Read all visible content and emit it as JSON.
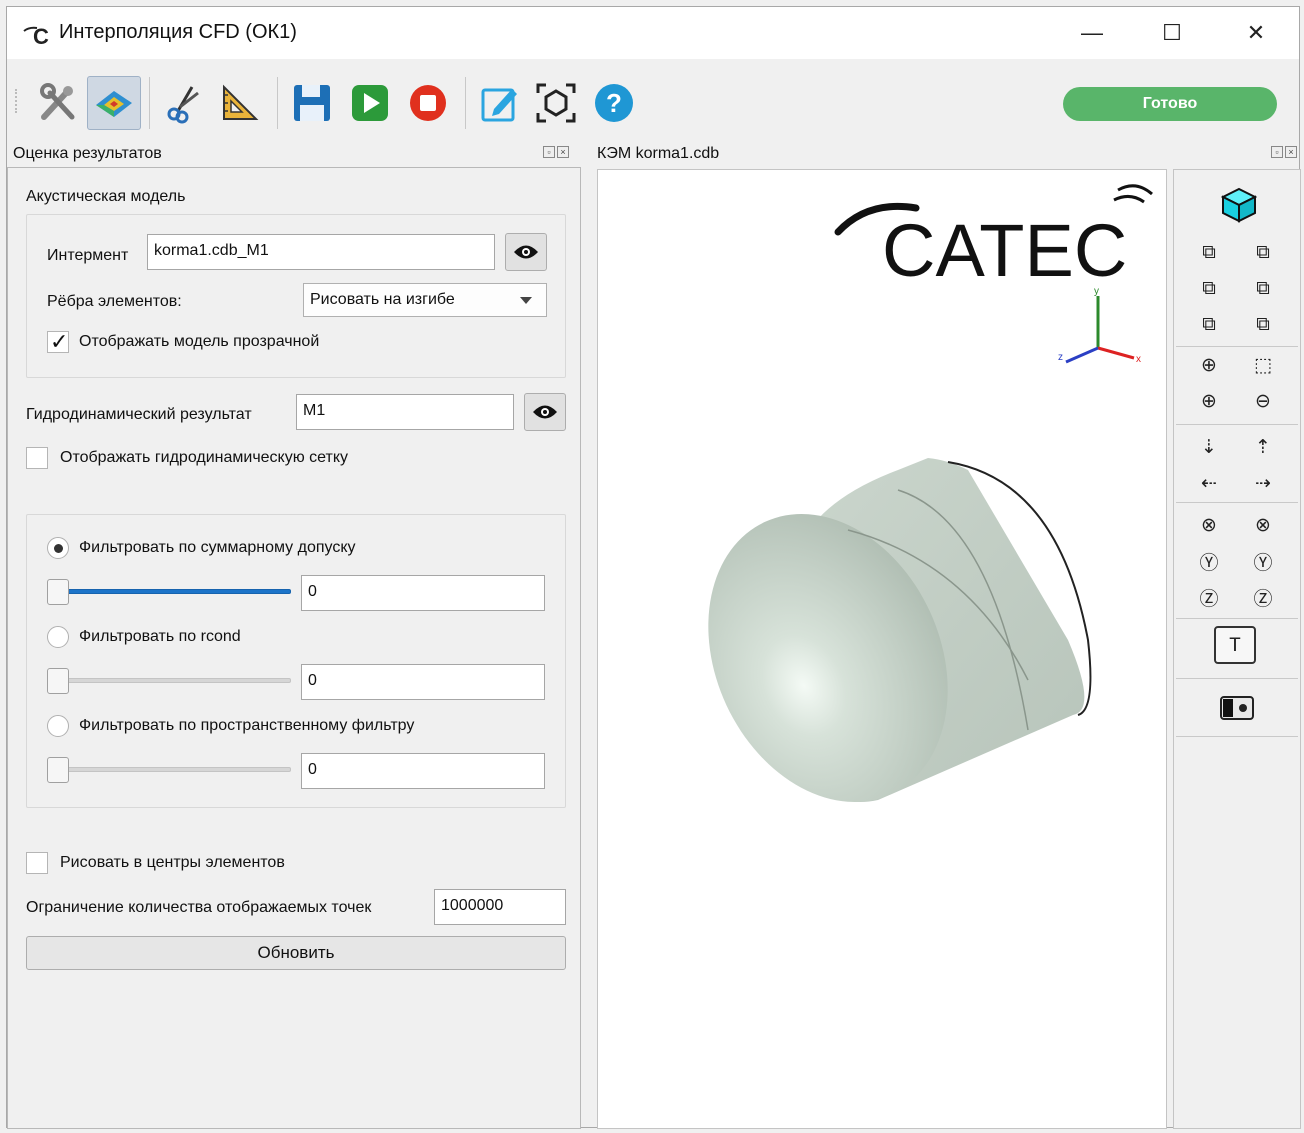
{
  "window": {
    "title": "Интерполяция CFD (ОК1)",
    "minimize": "—",
    "maximize": "☐",
    "close": "✕"
  },
  "toolbar": {
    "icons": [
      "tools-icon",
      "surface-map-icon",
      "cut-icon",
      "ruler-icon",
      "save-icon",
      "play-icon",
      "stop-icon",
      "edit-icon",
      "fit-view-icon",
      "help-icon"
    ],
    "status": "Готово",
    "status_color": "#59b56a"
  },
  "left_dock": {
    "title": "Оценка результатов",
    "acoustic": {
      "group_title": "Акустическая модель",
      "interment_label": "Интермент",
      "interment_value": "korma1.cdb_M1",
      "edges_label": "Рёбра элементов:",
      "edges_value": "Рисовать на изгибе",
      "transparent_label": "Отображать модель прозрачной",
      "transparent_checked": true
    },
    "hydro": {
      "result_label": "Гидродинамический результат",
      "result_value": "M1",
      "mesh_label": "Отображать гидродинамическую сетку",
      "mesh_checked": false
    },
    "filters": {
      "f1_label": "Фильтровать по суммарному допуску",
      "f1_value": "0",
      "f1_selected": true,
      "f2_label": "Фильтровать по rcond",
      "f2_value": "0",
      "f3_label": "Фильтровать по пространственному фильтру",
      "f3_value": "0"
    },
    "centers_label": "Рисовать в центры элементов",
    "limit_label": "Ограничение количества отображаемых точек",
    "limit_value": "1000000",
    "update_button": "Обновить"
  },
  "right_dock": {
    "title": "КЭМ korma1.cdb",
    "logo_text": "CATEC",
    "axes": {
      "x": "x",
      "y": "y",
      "z": "z"
    }
  },
  "colors": {
    "model": "#c9d3cb",
    "slider_fill": "#1c74c9",
    "cube": "#19d0e0"
  }
}
